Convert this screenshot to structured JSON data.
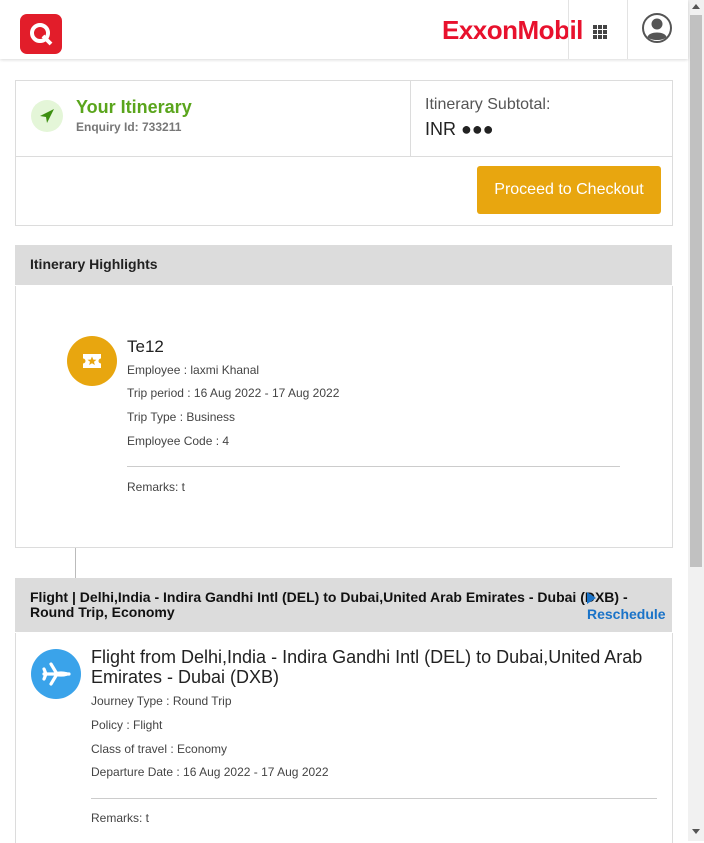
{
  "header": {
    "brand": "ExxonMobil",
    "colors": {
      "brand_red": "#e8112d",
      "logo_red": "#e21d2a"
    }
  },
  "summary": {
    "title": "Your Itinerary",
    "enquiry": "Enquiry Id: 733211",
    "subtotal_label": "Itinerary Subtotal:",
    "subtotal_value": "INR ●●●",
    "checkout_label": "Proceed to Checkout"
  },
  "highlights": {
    "heading": "Itinerary Highlights",
    "trip_name": "Te12",
    "employee": "Employee : laxmi Khanal",
    "trip_period": "Trip period : 16 Aug 2022 - 17 Aug 2022",
    "trip_type": "Trip Type : Business",
    "employee_code": "Employee Code : 4",
    "remarks": "Remarks: t"
  },
  "flight": {
    "heading": "Flight | Delhi,India - Indira Gandhi Intl (DEL) to Dubai,United Arab Emirates - Dubai (DXB) - Round Trip, Economy",
    "link": "Reschedule",
    "title": "Flight from Delhi,India - Indira Gandhi Intl (DEL) to Dubai,United Arab Emirates - Dubai (DXB)",
    "journey_type": "Journey Type : Round Trip",
    "policy": "Policy : Flight",
    "class": "Class of travel : Economy",
    "departure": "Departure Date : 16 Aug 2022 - 17 Aug 2022",
    "remarks": "Remarks: t"
  },
  "colors": {
    "accent_green": "#5aa51c",
    "checkout_orange": "#e8a60f",
    "flight_blue": "#3aa3ea",
    "section_grey": "#dcdcdc"
  }
}
